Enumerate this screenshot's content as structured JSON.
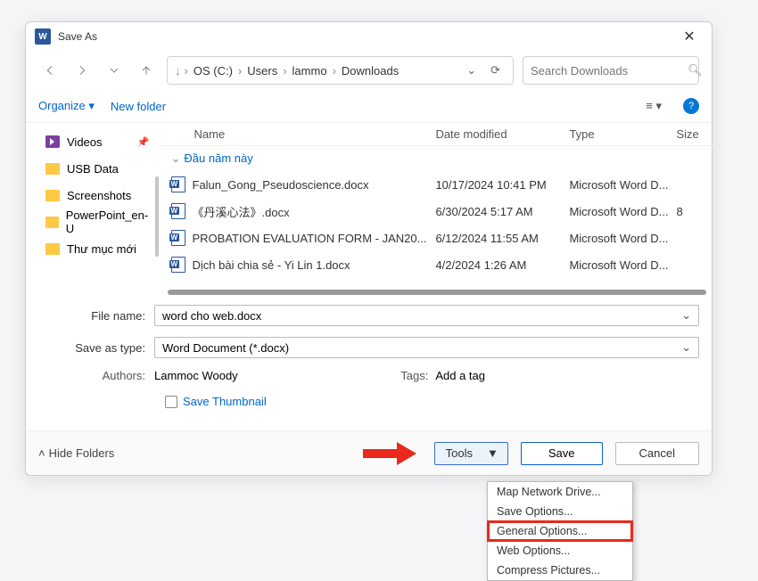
{
  "title": "Save As",
  "breadcrumb": [
    "OS (C:)",
    "Users",
    "lammo",
    "Downloads"
  ],
  "search_placeholder": "Search Downloads",
  "toolbar": {
    "organize": "Organize",
    "newfolder": "New folder"
  },
  "sidebar": {
    "items": [
      {
        "label": "Videos",
        "icon": "video",
        "pinned": true
      },
      {
        "label": "USB Data",
        "icon": "folder"
      },
      {
        "label": "Screenshots",
        "icon": "folder"
      },
      {
        "label": "PowerPoint_en-U",
        "icon": "folder"
      },
      {
        "label": "Thư mục mới",
        "icon": "folder"
      }
    ]
  },
  "columns": {
    "name": "Name",
    "date": "Date modified",
    "type": "Type",
    "size": "Size"
  },
  "group": "Đầu năm này",
  "files": [
    {
      "name": "Falun_Gong_Pseudoscience.docx",
      "date": "10/17/2024 10:41 PM",
      "type": "Microsoft Word D...",
      "size": ""
    },
    {
      "name": "《丹溪心法》.docx",
      "date": "6/30/2024 5:17 AM",
      "type": "Microsoft Word D...",
      "size": "8"
    },
    {
      "name": "PROBATION EVALUATION FORM - JAN20...",
      "date": "6/12/2024 11:55 AM",
      "type": "Microsoft Word D...",
      "size": ""
    },
    {
      "name": "Dịch bài chia sẻ - Yi Lin 1.docx",
      "date": "4/2/2024 1:26 AM",
      "type": "Microsoft Word D...",
      "size": ""
    }
  ],
  "form": {
    "filename_label": "File name:",
    "filename": "word cho web.docx",
    "saveastype_label": "Save as type:",
    "saveastype": "Word Document (*.docx)",
    "authors_label": "Authors:",
    "authors": "Lammoc Woody",
    "tags_label": "Tags:",
    "tags": "Add a tag",
    "thumbnail": "Save Thumbnail"
  },
  "footer": {
    "hide": "Hide Folders",
    "tools": "Tools",
    "save": "Save",
    "cancel": "Cancel"
  },
  "menu": [
    "Map Network Drive...",
    "Save Options...",
    "General Options...",
    "Web Options...",
    "Compress Pictures..."
  ]
}
